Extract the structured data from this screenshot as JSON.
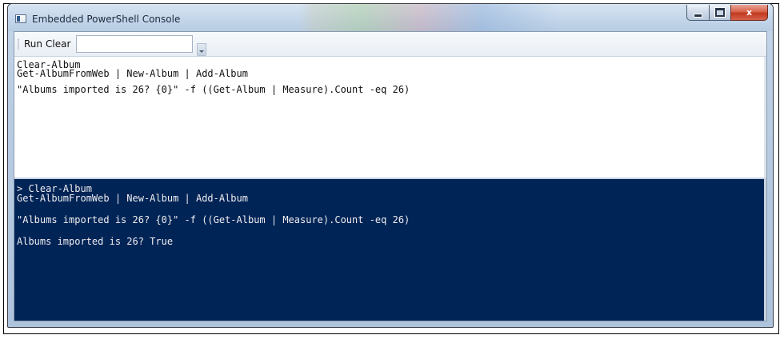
{
  "window": {
    "title": "Embedded PowerShell Console",
    "minimize_glyph": "",
    "maximize_glyph": "",
    "close_glyph": "x"
  },
  "toolbar": {
    "run_label": "Run",
    "clear_label": "Clear",
    "input_value": ""
  },
  "editor": {
    "lines": [
      "Clear-Album",
      "Get-AlbumFromWeb | New-Album | Add-Album",
      "\"Albums imported is 26? {0}\" -f ((Get-Album | Measure).Count -eq 26)"
    ]
  },
  "console": {
    "lines": [
      "> Clear-Album",
      "Get-AlbumFromWeb | New-Album | Add-Album",
      "\"Albums imported is 26? {0}\" -f ((Get-Album | Measure).Count -eq 26)",
      "Albums imported is 26? True"
    ]
  },
  "colors": {
    "console_background": "#012456",
    "console_text": "#eeedf0",
    "editor_background": "#ffffff",
    "close_button": "#c23a1f"
  }
}
